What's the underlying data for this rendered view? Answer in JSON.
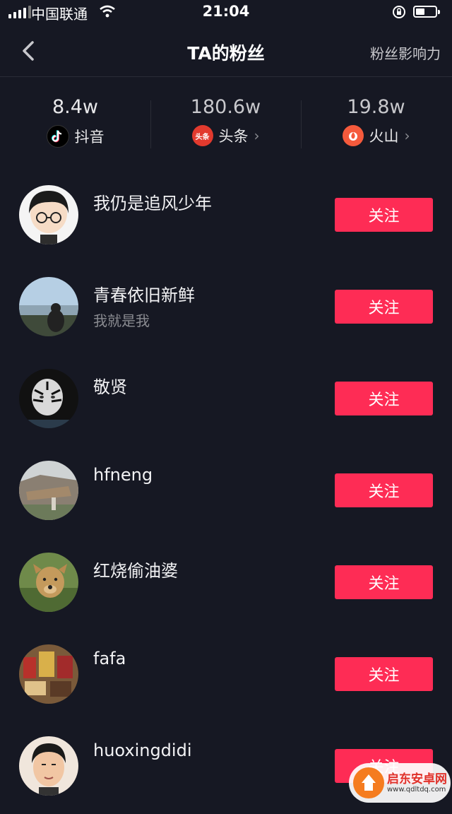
{
  "status_bar": {
    "carrier": "中国联通",
    "time": "21:04",
    "battery_level_pct": 45
  },
  "nav": {
    "title": "TA的粉丝",
    "right_link": "粉丝影响力"
  },
  "stats": [
    {
      "value": "8.4w",
      "platform": "抖音",
      "chevron": ""
    },
    {
      "value": "180.6w",
      "platform": "头条",
      "logo_text": "头条",
      "chevron": "›"
    },
    {
      "value": "19.8w",
      "platform": "火山",
      "chevron": "›"
    }
  ],
  "followers": [
    {
      "name": "我仍是追风少年",
      "signature": "",
      "button": "关注"
    },
    {
      "name": "青春依旧新鲜",
      "signature": "我就是我",
      "button": "关注"
    },
    {
      "name": "敬贤",
      "signature": "",
      "button": "关注"
    },
    {
      "name": "hfneng",
      "signature": "",
      "button": "关注"
    },
    {
      "name": "红烧偷油婆",
      "signature": "",
      "button": "关注"
    },
    {
      "name": "fafa",
      "signature": "",
      "button": "关注"
    },
    {
      "name": "huoxingdidi",
      "signature": "",
      "button": "关注"
    }
  ],
  "watermark": {
    "text_cn": "启东安卓网",
    "text_url": "www.qdltdq.com"
  },
  "colors": {
    "background": "#161823",
    "accent": "#fe2c55",
    "muted": "#8a8b91"
  }
}
